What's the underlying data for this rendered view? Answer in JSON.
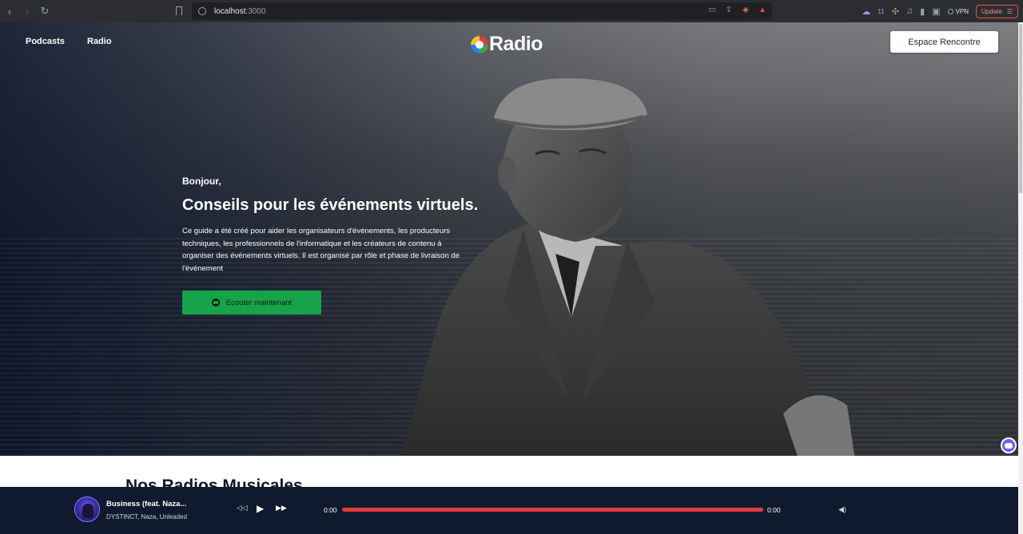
{
  "browser": {
    "url_host": "localhost",
    "url_port": ":3000",
    "vpn_label": "VPN",
    "update_label": "Update",
    "ext_badge": "11"
  },
  "nav": {
    "podcasts": "Podcasts",
    "radio": "Radio",
    "logo_text": "Radio",
    "cta": "Espace Rencontre"
  },
  "hero": {
    "greeting": "Bonjour,",
    "headline": "Conseils pour les événements virtuels.",
    "description": "Ce guide a été créé pour aider les organisateurs d'événements, les producteurs techniques, les professionnels de l'informatique et les créateurs de contenu à organiser des événements virtuels. Il est organisé par rôle et phase de livraison de l'événement",
    "button": "Ecouter maintenant"
  },
  "section": {
    "title": "Nos Radios Musicales"
  },
  "player": {
    "title": "Business (feat. Naza...",
    "artists": "DYSTINCT, Naza, Unleaded",
    "current_time": "0:00",
    "duration": "0:00",
    "progress_fraction": 0
  },
  "colors": {
    "accent_green": "#16a34a",
    "progress_red": "#e53e3e",
    "player_bg": "#101a2e"
  }
}
